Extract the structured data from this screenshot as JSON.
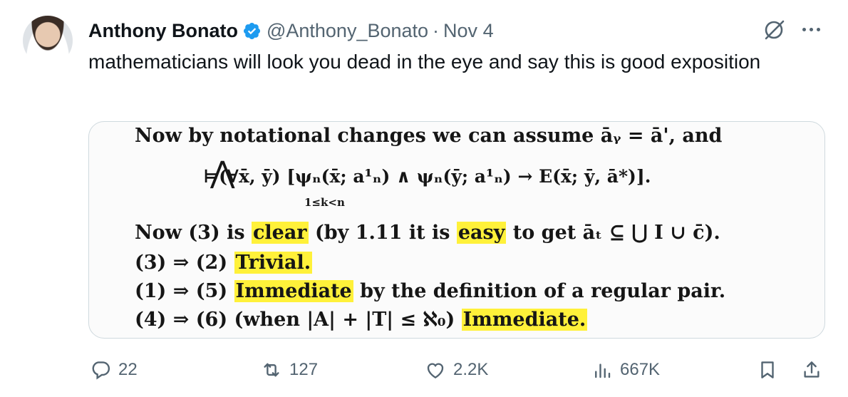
{
  "author": {
    "display_name": "Anthony Bonato",
    "handle": "@Anthony_Bonato",
    "separator": "·",
    "date": "Nov 4"
  },
  "tweet": {
    "text": "mathematicians will look you dead in the eye and say this is good exposition"
  },
  "media": {
    "line1": "Now by notational changes we can assume āᵧ = ā', and",
    "line2": "⊨(∀x̄, ȳ)          [ψₙ(x̄; a¹ₙ) ∧ ψₙ(ȳ; a¹ₙ) → E(x̄; ȳ, ā*)].",
    "wedge": "⋀",
    "wedge_sub": "1≤k<n",
    "line3_pre": "Now (3) is ",
    "line3_hl1": "clear",
    "line3_mid": " (by 1.11 it is ",
    "line3_hl2": "easy",
    "line3_post": " to get āₜ ⊆ ⋃ I ∪ c̄).",
    "line4_pre": "(3) ⇒ (2) ",
    "line4_hl": "Trivial.",
    "line5_pre": "(1) ⇒ (5) ",
    "line5_hl": "Immediate",
    "line5_post": " by the definition of a regular pair.",
    "line6_pre": "(4) ⇒ (6) (when |A| + |T| ≤ ℵ₀) ",
    "line6_hl": "Immediate."
  },
  "actions": {
    "replies": "22",
    "reposts": "127",
    "likes": "2.2K",
    "views": "667K"
  },
  "icons": [
    "avatar",
    "verified-badge-icon",
    "grok-icon",
    "more-icon",
    "reply-icon",
    "repost-icon",
    "like-icon",
    "views-icon",
    "bookmark-icon",
    "share-icon"
  ],
  "colors": {
    "verified": "#1d9bf0",
    "muted": "#536471",
    "highlight": "#fff13a"
  }
}
